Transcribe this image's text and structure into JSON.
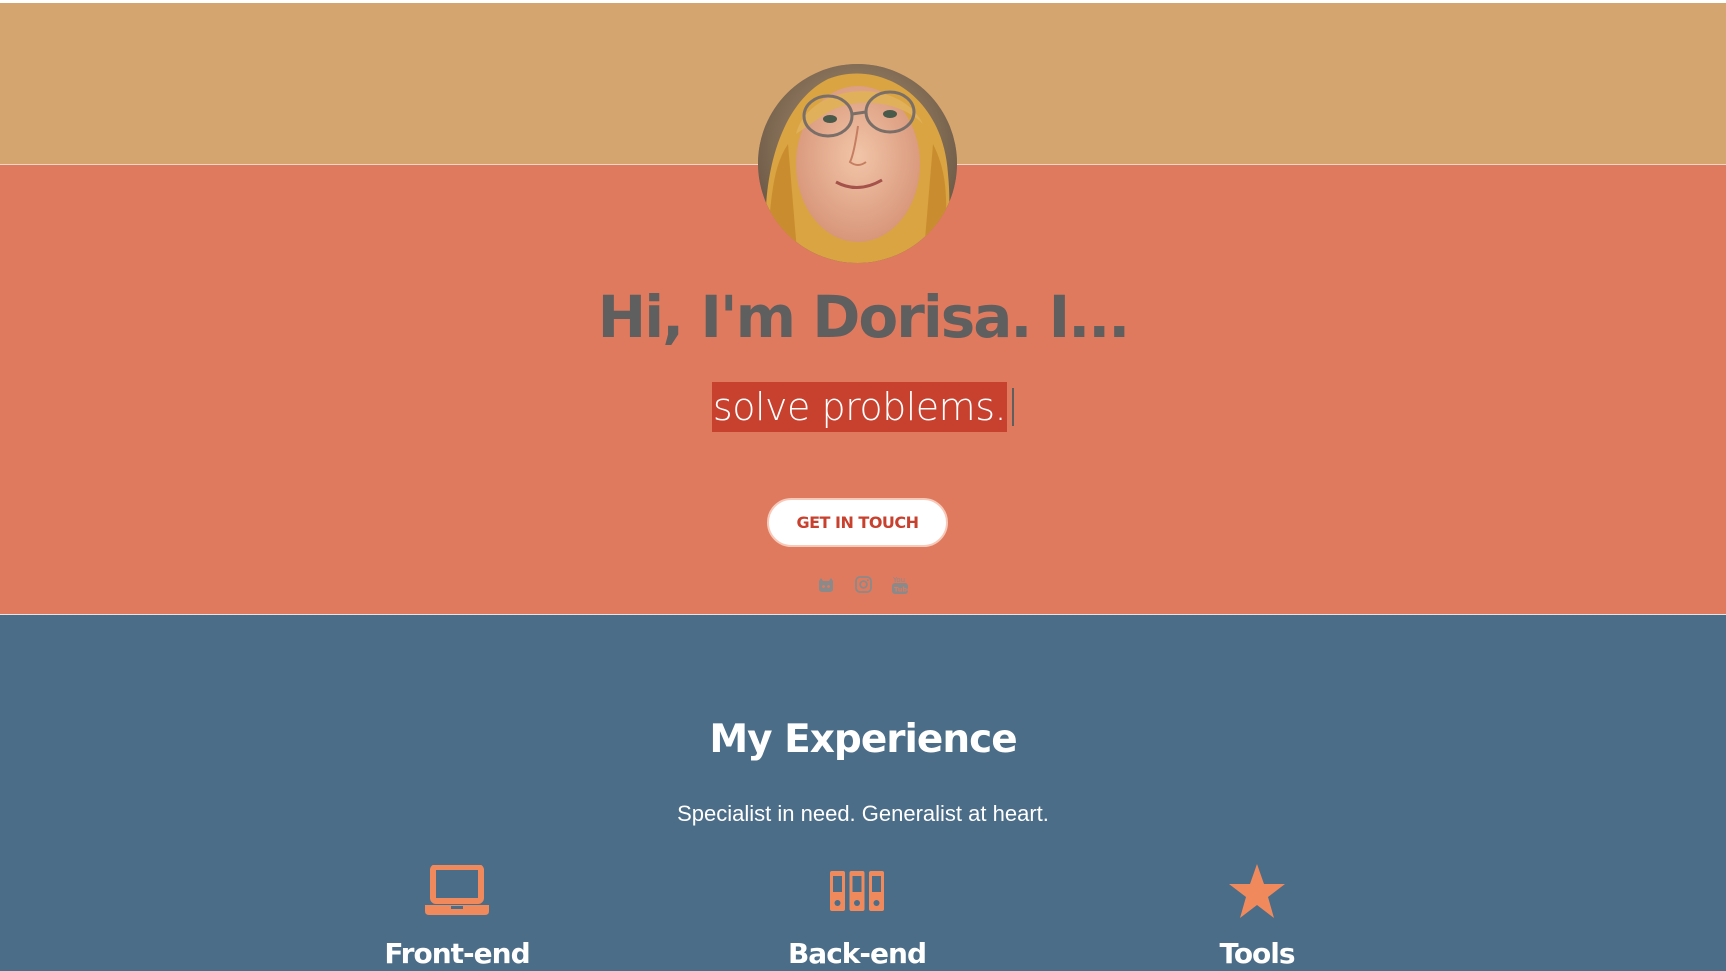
{
  "hero": {
    "title": "Hi, I'm Dorisa. I...",
    "typed_text": "solve problems.",
    "cta_label": "GET IN TOUCH",
    "social_icons": [
      "github-icon",
      "instagram-icon",
      "youtube-icon"
    ]
  },
  "experience": {
    "title": "My Experience",
    "subtitle": "Specialist in need. Generalist at heart.",
    "columns": [
      {
        "icon": "laptop-icon",
        "label": "Front-end"
      },
      {
        "icon": "server-icon",
        "label": "Back-end"
      },
      {
        "icon": "star-icon",
        "label": "Tools"
      }
    ]
  },
  "colors": {
    "top_band": "#d4a56e",
    "hero_band": "#e07a5f",
    "experience_band": "#4b6d88",
    "accent": "#c8412f",
    "icon_accent": "#f08a5d"
  }
}
